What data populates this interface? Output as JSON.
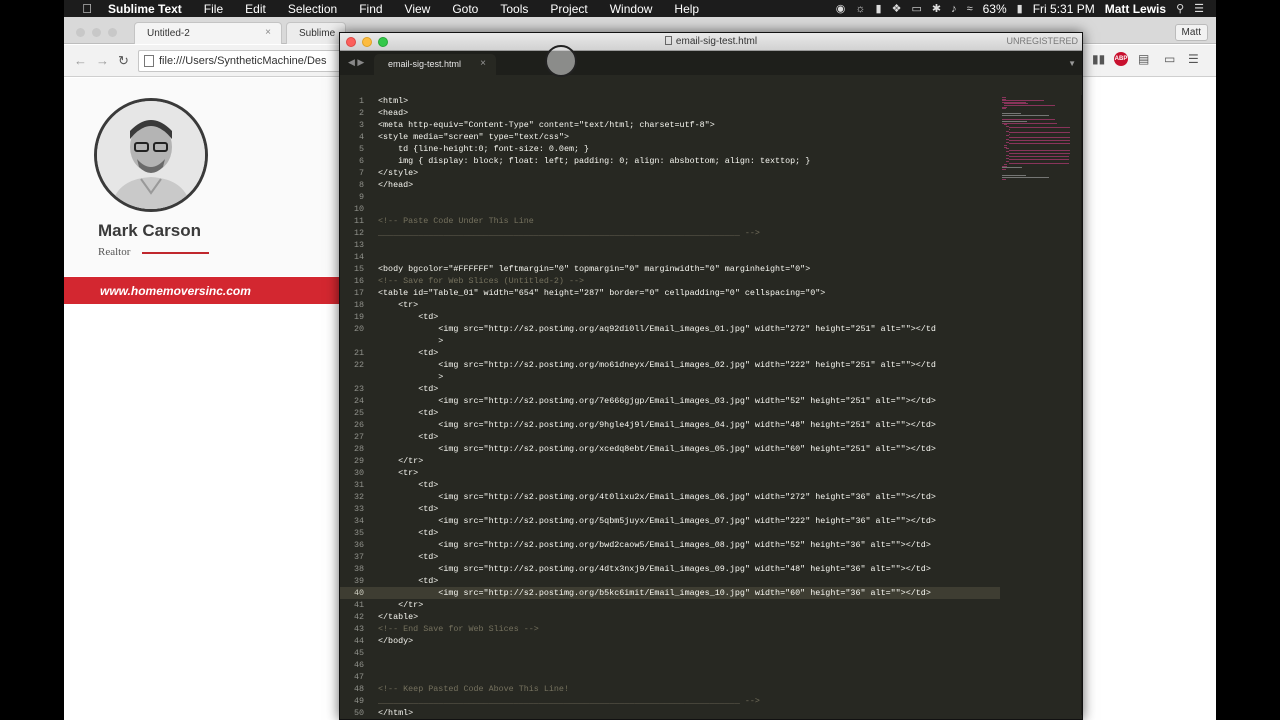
{
  "menubar": {
    "app": "Sublime Text",
    "items": [
      "File",
      "Edit",
      "Selection",
      "Find",
      "View",
      "Goto",
      "Tools",
      "Project",
      "Window",
      "Help"
    ],
    "battery": "63%",
    "clock": "Fri 5:31 PM",
    "user": "Matt Lewis"
  },
  "chrome": {
    "tab1": "Untitled-2",
    "tab2": "Sublime",
    "url": "file:///Users/SyntheticMachine/Des",
    "user_button": "Matt"
  },
  "signature": {
    "name": "Mark Carson",
    "role": "Realtor",
    "website": "www.homemoversinc.com"
  },
  "sublime": {
    "window_title": "email-sig-test.html",
    "unregistered": "UNREGISTERED",
    "tab": "email-sig-test.html",
    "current_line": 40,
    "lines": [
      {
        "n": "1",
        "t": "<html>"
      },
      {
        "n": "2",
        "t": "<head>"
      },
      {
        "n": "3",
        "t": "<meta http-equiv=\"Content-Type\" content=\"text/html; charset=utf-8\">"
      },
      {
        "n": "4",
        "t": "<style media=\"screen\" type=\"text/css\">"
      },
      {
        "n": "5",
        "t": "    td {line-height:0; font-size: 0.0em; }"
      },
      {
        "n": "6",
        "t": "    img { display: block; float: left; padding: 0; align: absbottom; align: texttop; }"
      },
      {
        "n": "7",
        "t": "</style>"
      },
      {
        "n": "8",
        "t": "</head>"
      },
      {
        "n": "9",
        "t": ""
      },
      {
        "n": "10",
        "t": ""
      },
      {
        "n": "11",
        "t": "<!-- Paste Code Under This Line"
      },
      {
        "n": "12",
        "t": "________________________________________________________________________ -->"
      },
      {
        "n": "13",
        "t": ""
      },
      {
        "n": "14",
        "t": ""
      },
      {
        "n": "15",
        "t": "<body bgcolor=\"#FFFFFF\" leftmargin=\"0\" topmargin=\"0\" marginwidth=\"0\" marginheight=\"0\">"
      },
      {
        "n": "16",
        "t": "<!-- Save for Web Slices (Untitled-2) -->"
      },
      {
        "n": "17",
        "t": "<table id=\"Table_01\" width=\"654\" height=\"287\" border=\"0\" cellpadding=\"0\" cellspacing=\"0\">"
      },
      {
        "n": "18",
        "t": "    <tr>"
      },
      {
        "n": "19",
        "t": "        <td>"
      },
      {
        "n": "20",
        "t": "            <img src=\"http://s2.postimg.org/aq92di0ll/Email_images_01.jpg\" width=\"272\" height=\"251\" alt=\"\"></td"
      },
      {
        "n": "",
        "t": "            >"
      },
      {
        "n": "21",
        "t": "        <td>"
      },
      {
        "n": "22",
        "t": "            <img src=\"http://s2.postimg.org/mo61dneyx/Email_images_02.jpg\" width=\"222\" height=\"251\" alt=\"\"></td"
      },
      {
        "n": "",
        "t": "            >"
      },
      {
        "n": "23",
        "t": "        <td>"
      },
      {
        "n": "24",
        "t": "            <img src=\"http://s2.postimg.org/7e666gjgp/Email_images_03.jpg\" width=\"52\" height=\"251\" alt=\"\"></td>"
      },
      {
        "n": "25",
        "t": "        <td>"
      },
      {
        "n": "26",
        "t": "            <img src=\"http://s2.postimg.org/9hgle4j9l/Email_images_04.jpg\" width=\"48\" height=\"251\" alt=\"\"></td>"
      },
      {
        "n": "27",
        "t": "        <td>"
      },
      {
        "n": "28",
        "t": "            <img src=\"http://s2.postimg.org/xcedq8ebt/Email_images_05.jpg\" width=\"60\" height=\"251\" alt=\"\"></td>"
      },
      {
        "n": "29",
        "t": "    </tr>"
      },
      {
        "n": "30",
        "t": "    <tr>"
      },
      {
        "n": "31",
        "t": "        <td>"
      },
      {
        "n": "32",
        "t": "            <img src=\"http://s2.postimg.org/4t0lixu2x/Email_images_06.jpg\" width=\"272\" height=\"36\" alt=\"\"></td>"
      },
      {
        "n": "33",
        "t": "        <td>"
      },
      {
        "n": "34",
        "t": "            <img src=\"http://s2.postimg.org/5qbm5juyx/Email_images_07.jpg\" width=\"222\" height=\"36\" alt=\"\"></td>"
      },
      {
        "n": "35",
        "t": "        <td>"
      },
      {
        "n": "36",
        "t": "            <img src=\"http://s2.postimg.org/bwd2caow5/Email_images_08.jpg\" width=\"52\" height=\"36\" alt=\"\"></td>"
      },
      {
        "n": "37",
        "t": "        <td>"
      },
      {
        "n": "38",
        "t": "            <img src=\"http://s2.postimg.org/4dtx3nxj9/Email_images_09.jpg\" width=\"48\" height=\"36\" alt=\"\"></td>"
      },
      {
        "n": "39",
        "t": "        <td>"
      },
      {
        "n": "40",
        "t": "            <img src=\"http://s2.postimg.org/b5kc6imit/Email_images_10.jpg\" width=\"60\" height=\"36\" alt=\"\"></td>"
      },
      {
        "n": "41",
        "t": "    </tr>"
      },
      {
        "n": "42",
        "t": "</table>"
      },
      {
        "n": "43",
        "t": "<!-- End Save for Web Slices -->"
      },
      {
        "n": "44",
        "t": "</body>"
      },
      {
        "n": "45",
        "t": ""
      },
      {
        "n": "46",
        "t": ""
      },
      {
        "n": "47",
        "t": ""
      },
      {
        "n": "48",
        "t": "<!-- Keep Pasted Code Above This Line!"
      },
      {
        "n": "49",
        "t": "________________________________________________________________________ -->"
      },
      {
        "n": "50",
        "t": "</html>"
      }
    ]
  },
  "colors": {
    "sublime_bg": "#272822",
    "brand_red": "#d32730"
  }
}
